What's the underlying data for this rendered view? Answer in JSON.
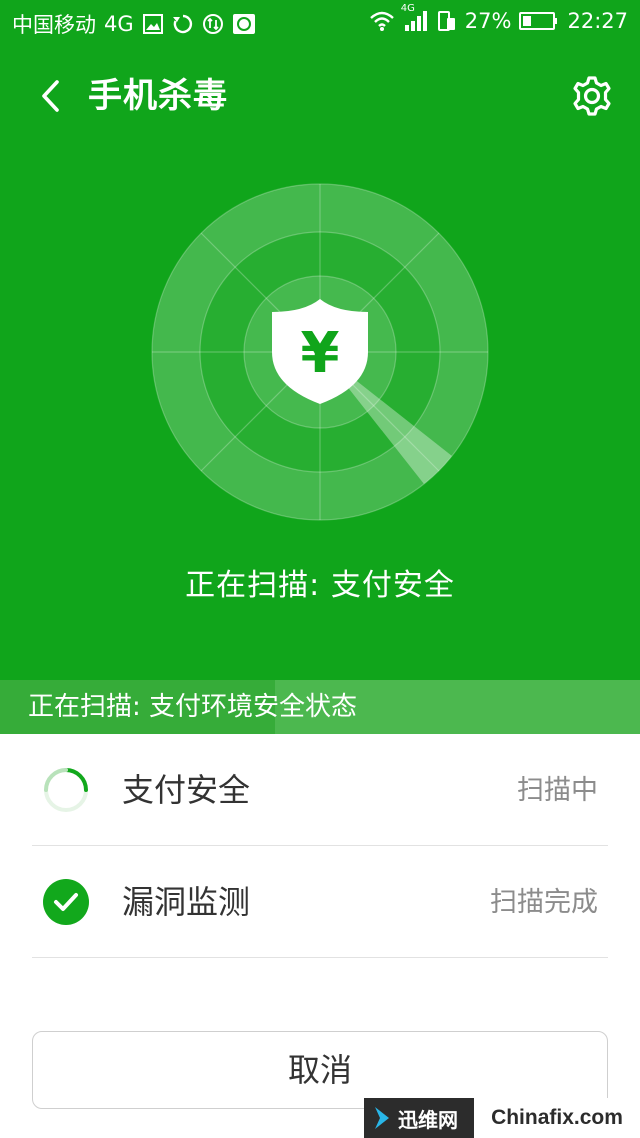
{
  "status_bar": {
    "carrier": "中国移动",
    "network": "4G",
    "signal_network": "4G",
    "battery": "27%",
    "time": "22:27",
    "icons": [
      "gallery-icon",
      "sync-icon",
      "data-sync-icon",
      "10086-icon",
      "wifi-icon",
      "signal-icon",
      "sim-icon",
      "battery-icon"
    ]
  },
  "header": {
    "title": "手机杀毒",
    "back_icon": "chevron-left-icon",
    "settings_icon": "gear-icon"
  },
  "scanner": {
    "shield_symbol": "¥",
    "status_text": "正在扫描: 支付安全"
  },
  "progress": {
    "text": "正在扫描: 支付环境安全状态",
    "fraction": 0.43
  },
  "checks": [
    {
      "label": "支付安全",
      "status": "扫描中",
      "state": "scanning"
    },
    {
      "label": "漏洞监测",
      "status": "扫描完成",
      "state": "done"
    }
  ],
  "actions": {
    "cancel_label": "取消"
  },
  "watermark": {
    "left": "迅维网",
    "right": "Chinafix.com"
  },
  "colors": {
    "primary_green": "#10a51b",
    "progress_strip": "#4cb84f",
    "status_gray": "#8c8c8c"
  }
}
